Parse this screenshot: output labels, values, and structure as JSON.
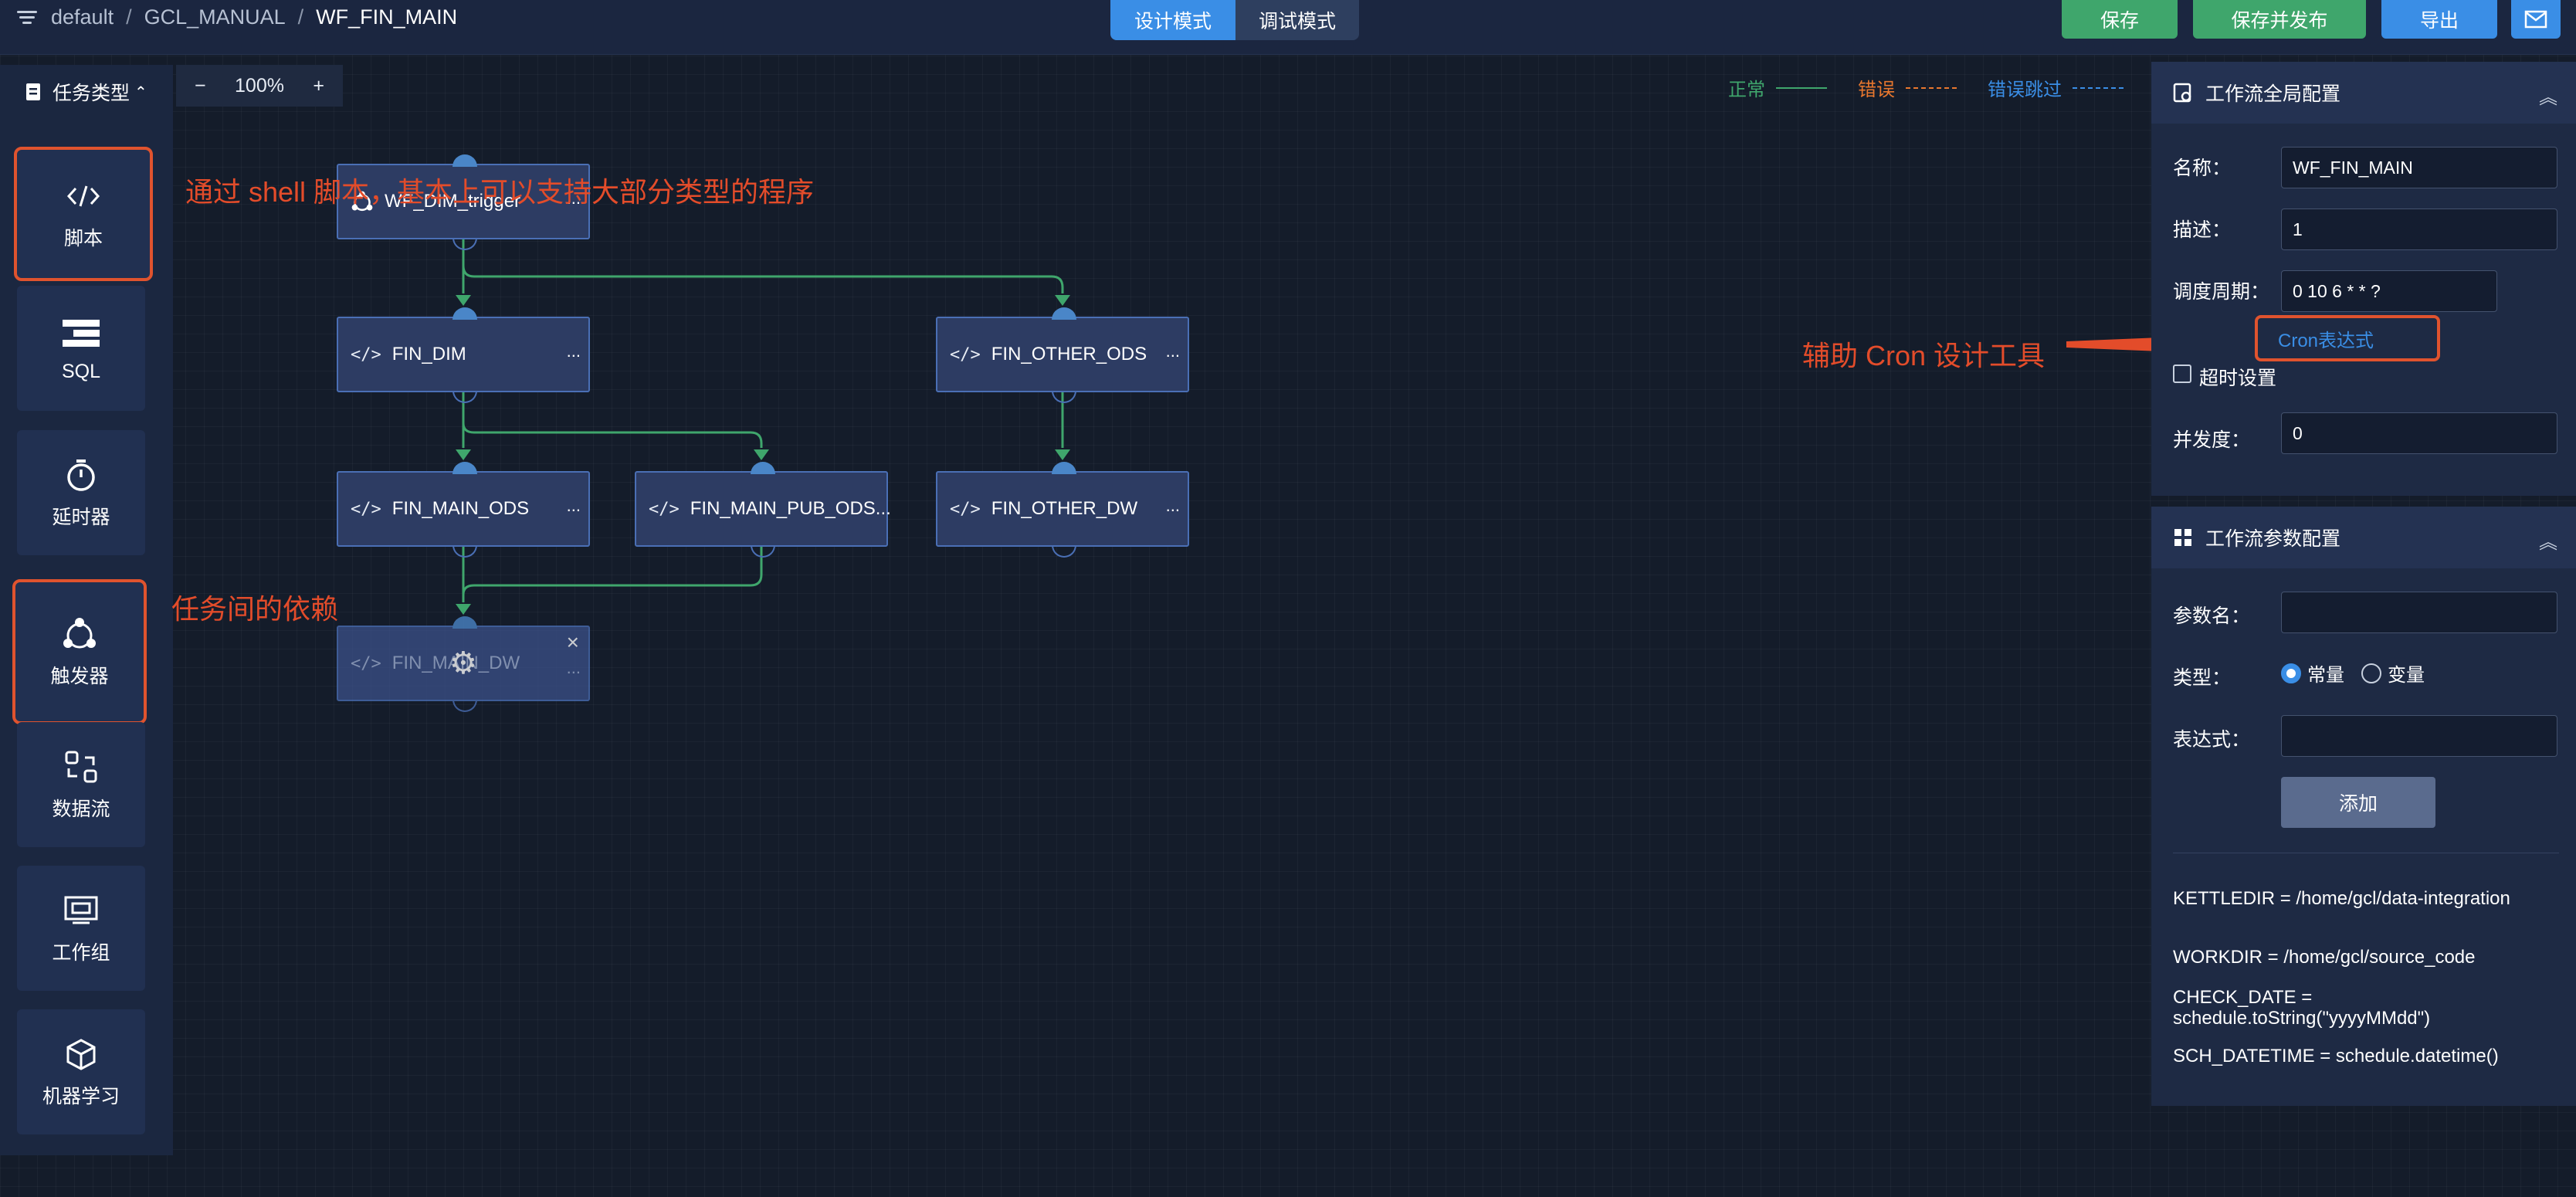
{
  "breadcrumb": [
    "default",
    "GCL_MANUAL",
    "WF_FIN_MAIN"
  ],
  "modes": {
    "design": "设计模式",
    "debug": "调试模式"
  },
  "actions": {
    "save": "保存",
    "save_publish": "保存并发布",
    "export": "导出"
  },
  "sidebar": {
    "header": "任务类型",
    "items": [
      {
        "label": "脚本",
        "icon": "code-icon"
      },
      {
        "label": "SQL",
        "icon": "sql-icon"
      },
      {
        "label": "延时器",
        "icon": "timer-icon"
      },
      {
        "label": "触发器",
        "icon": "trigger-icon"
      },
      {
        "label": "数据流",
        "icon": "dataflow-icon"
      },
      {
        "label": "工作组",
        "icon": "workgroup-icon"
      },
      {
        "label": "机器学习",
        "icon": "cube-icon"
      }
    ]
  },
  "zoom": {
    "minus": "−",
    "value": "100%",
    "plus": "+"
  },
  "legend": {
    "normal": {
      "label": "正常",
      "color": "#3fa66c"
    },
    "error": {
      "label": "错误",
      "color": "#e8772e"
    },
    "error_skip": {
      "label": "错误跳过",
      "color": "#3a8ee6"
    }
  },
  "nodes": {
    "trigger": "WF_DIM_trigger",
    "fin_dim": "FIN_DIM",
    "fin_other_ods": "FIN_OTHER_ODS",
    "fin_main_ods": "FIN_MAIN_ODS",
    "fin_main_pub_ods": "FIN_MAIN_PUB_ODS...",
    "fin_other_dw": "FIN_OTHER_DW",
    "fin_main_dw": "FIN_MAIN_DW",
    "more": "..."
  },
  "annotations": {
    "shell": "通过 shell 脚本，基本上可以支持大部分类型的程序",
    "dependency": "任务间的依赖",
    "cron": "辅助 Cron 设计工具"
  },
  "global_config": {
    "title": "工作流全局配置",
    "name_label": "名称：",
    "name_value": "WF_FIN_MAIN",
    "desc_label": "描述：",
    "desc_value": "1",
    "cron_label": "调度周期：",
    "cron_value": "0 10 6 * * ?",
    "cron_tool": "Cron表达式",
    "timeout_label": "超时设置",
    "concurrency_label": "并发度：",
    "concurrency_value": "0"
  },
  "param_config": {
    "title": "工作流参数配置",
    "param_name_label": "参数名：",
    "type_label": "类型：",
    "type_constant": "常量",
    "type_variable": "变量",
    "expr_label": "表达式：",
    "add_button": "添加",
    "params": [
      "KETTLEDIR = /home/gcl/data-integration",
      "WORKDIR = /home/gcl/source_code",
      "CHECK_DATE = schedule.toString(\"yyyyMMdd\")",
      "SCH_DATETIME = schedule.datetime()"
    ]
  }
}
